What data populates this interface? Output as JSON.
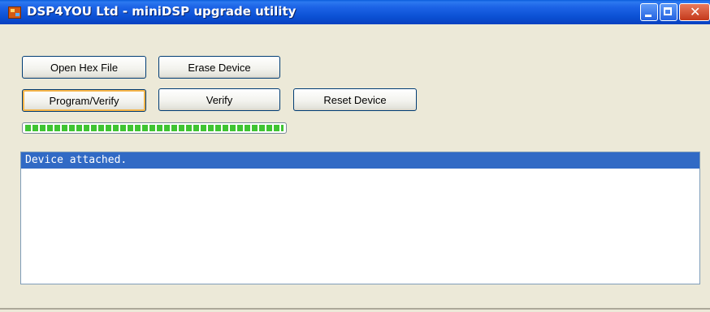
{
  "window": {
    "title": "DSP4YOU Ltd - miniDSP upgrade utility",
    "title_bar_color": "#0b50d3",
    "icons": {
      "app": "app-icon",
      "minimize": "minimize-icon",
      "maximize": "maximize-icon",
      "close": "close-icon"
    }
  },
  "buttons": {
    "open_hex_file": "Open Hex File",
    "erase_device": "Erase Device",
    "program_verify": "Program/Verify",
    "verify": "Verify",
    "reset_device": "Reset Device"
  },
  "progress": {
    "value_percent": 100,
    "color": "#3fc432"
  },
  "log": {
    "items": [
      "Device attached."
    ],
    "selected_color": "#316ac5"
  }
}
